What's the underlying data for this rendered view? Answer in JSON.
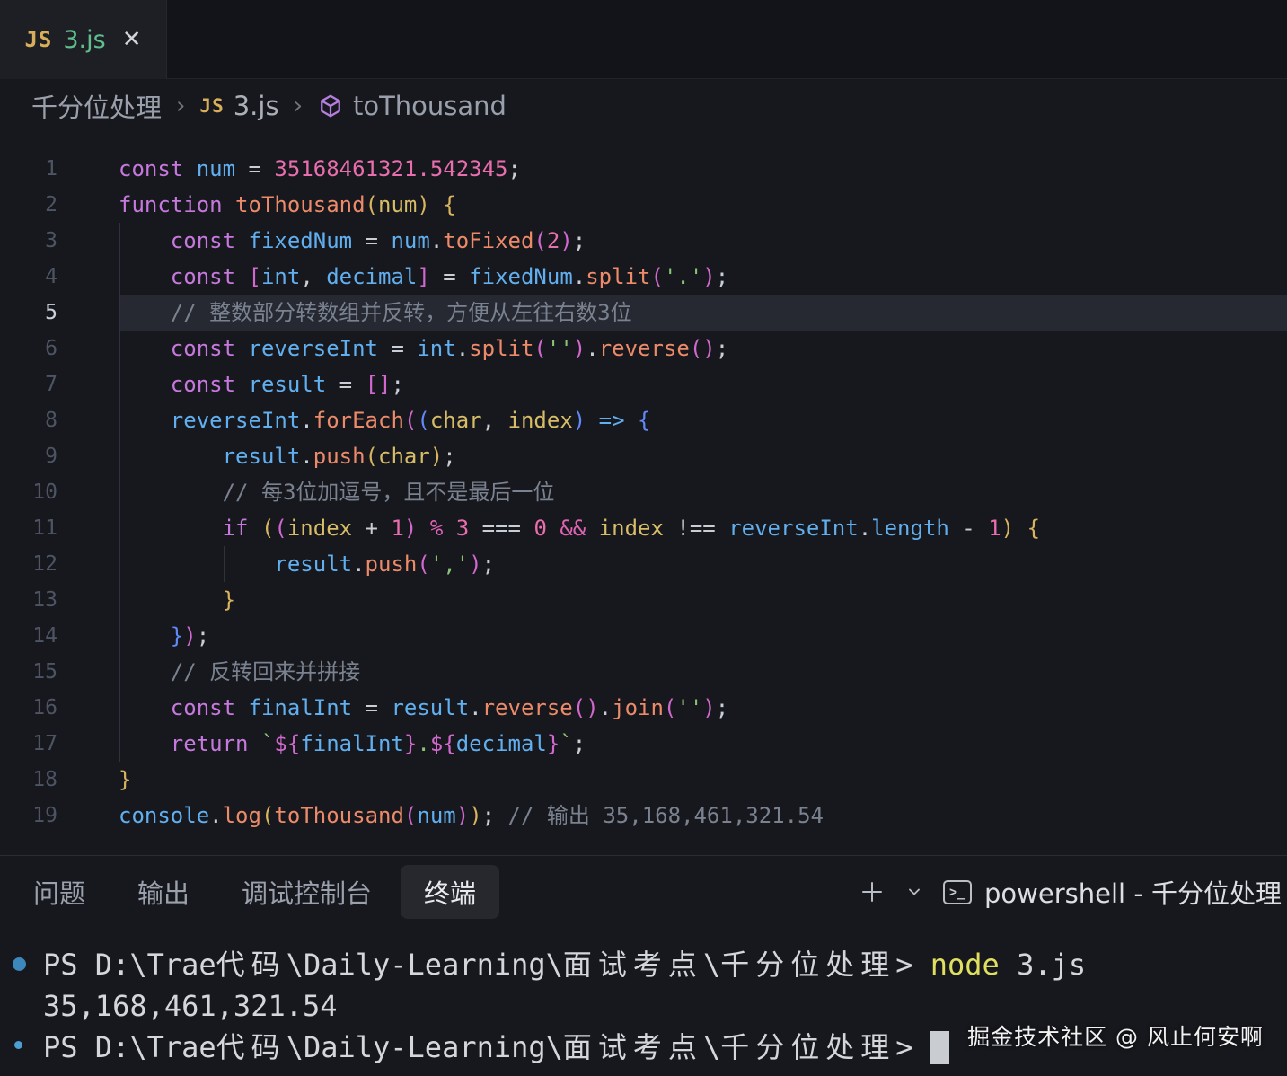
{
  "tab": {
    "icon": "JS",
    "filename": "3.js",
    "close": "✕"
  },
  "breadcrumb": {
    "folder": "千分位处理",
    "separator": "›",
    "file_icon": "JS",
    "file": "3.js",
    "symbol": "toThousand"
  },
  "editor": {
    "lines": [
      {
        "n": "1",
        "indent": 0,
        "highlight": false,
        "tokens": [
          [
            "kw",
            "const"
          ],
          [
            "op",
            " "
          ],
          [
            "var",
            "num"
          ],
          [
            "op",
            " = "
          ],
          [
            "num",
            "35168461321.542345"
          ],
          [
            "op",
            ";"
          ]
        ]
      },
      {
        "n": "2",
        "indent": 0,
        "highlight": false,
        "tokens": [
          [
            "kw",
            "function"
          ],
          [
            "op",
            " "
          ],
          [
            "fn",
            "toThousand"
          ],
          [
            "b1",
            "("
          ],
          [
            "param",
            "num"
          ],
          [
            "b1",
            ")"
          ],
          [
            "op",
            " "
          ],
          [
            "b1",
            "{"
          ]
        ]
      },
      {
        "n": "3",
        "indent": 1,
        "highlight": false,
        "tokens": [
          [
            "kw",
            "const"
          ],
          [
            "op",
            " "
          ],
          [
            "var",
            "fixedNum"
          ],
          [
            "op",
            " = "
          ],
          [
            "var",
            "num"
          ],
          [
            "op",
            "."
          ],
          [
            "fn",
            "toFixed"
          ],
          [
            "b2",
            "("
          ],
          [
            "num",
            "2"
          ],
          [
            "b2",
            ")"
          ],
          [
            "op",
            ";"
          ]
        ]
      },
      {
        "n": "4",
        "indent": 1,
        "highlight": false,
        "tokens": [
          [
            "kw",
            "const"
          ],
          [
            "op",
            " "
          ],
          [
            "b2",
            "["
          ],
          [
            "var",
            "int"
          ],
          [
            "op",
            ", "
          ],
          [
            "var",
            "decimal"
          ],
          [
            "b2",
            "]"
          ],
          [
            "op",
            " = "
          ],
          [
            "var",
            "fixedNum"
          ],
          [
            "op",
            "."
          ],
          [
            "fn",
            "split"
          ],
          [
            "b2",
            "("
          ],
          [
            "str",
            "'.'"
          ],
          [
            "b2",
            ")"
          ],
          [
            "op",
            ";"
          ]
        ]
      },
      {
        "n": "5",
        "indent": 1,
        "highlight": true,
        "tokens": [
          [
            "com",
            "// 整数部分转数组并反转，方便从左往右数3位"
          ]
        ]
      },
      {
        "n": "6",
        "indent": 1,
        "highlight": false,
        "tokens": [
          [
            "kw",
            "const"
          ],
          [
            "op",
            " "
          ],
          [
            "var",
            "reverseInt"
          ],
          [
            "op",
            " = "
          ],
          [
            "var",
            "int"
          ],
          [
            "op",
            "."
          ],
          [
            "fn",
            "split"
          ],
          [
            "b2",
            "("
          ],
          [
            "str",
            "''"
          ],
          [
            "b2",
            ")"
          ],
          [
            "op",
            "."
          ],
          [
            "fn",
            "reverse"
          ],
          [
            "b2",
            "()"
          ],
          [
            "op",
            ";"
          ]
        ]
      },
      {
        "n": "7",
        "indent": 1,
        "highlight": false,
        "tokens": [
          [
            "kw",
            "const"
          ],
          [
            "op",
            " "
          ],
          [
            "var",
            "result"
          ],
          [
            "op",
            " = "
          ],
          [
            "b2",
            "[]"
          ],
          [
            "op",
            ";"
          ]
        ]
      },
      {
        "n": "8",
        "indent": 1,
        "highlight": false,
        "tokens": [
          [
            "var",
            "reverseInt"
          ],
          [
            "op",
            "."
          ],
          [
            "fn",
            "forEach"
          ],
          [
            "b2",
            "("
          ],
          [
            "b3",
            "("
          ],
          [
            "param",
            "char"
          ],
          [
            "op",
            ", "
          ],
          [
            "param",
            "index"
          ],
          [
            "b3",
            ")"
          ],
          [
            "op",
            " "
          ],
          [
            "arrow",
            "=>"
          ],
          [
            "op",
            " "
          ],
          [
            "b3",
            "{"
          ]
        ]
      },
      {
        "n": "9",
        "indent": 2,
        "highlight": false,
        "tokens": [
          [
            "var",
            "result"
          ],
          [
            "op",
            "."
          ],
          [
            "fn",
            "push"
          ],
          [
            "b1",
            "("
          ],
          [
            "param",
            "char"
          ],
          [
            "b1",
            ")"
          ],
          [
            "op",
            ";"
          ]
        ]
      },
      {
        "n": "10",
        "indent": 2,
        "highlight": false,
        "tokens": [
          [
            "com",
            "// 每3位加逗号，且不是最后一位"
          ]
        ]
      },
      {
        "n": "11",
        "indent": 2,
        "highlight": false,
        "tokens": [
          [
            "kw",
            "if"
          ],
          [
            "op",
            " "
          ],
          [
            "b1",
            "("
          ],
          [
            "b2",
            "("
          ],
          [
            "param",
            "index"
          ],
          [
            "op",
            " + "
          ],
          [
            "num",
            "1"
          ],
          [
            "b2",
            ")"
          ],
          [
            "op",
            " "
          ],
          [
            "opm",
            "%"
          ],
          [
            "op",
            " "
          ],
          [
            "num",
            "3"
          ],
          [
            "op",
            " === "
          ],
          [
            "num",
            "0"
          ],
          [
            "op",
            " "
          ],
          [
            "opm",
            "&&"
          ],
          [
            "op",
            " "
          ],
          [
            "param",
            "index"
          ],
          [
            "op",
            " !== "
          ],
          [
            "var",
            "reverseInt"
          ],
          [
            "op",
            "."
          ],
          [
            "var",
            "length"
          ],
          [
            "op",
            " - "
          ],
          [
            "num",
            "1"
          ],
          [
            "b1",
            ")"
          ],
          [
            "op",
            " "
          ],
          [
            "b1",
            "{"
          ]
        ]
      },
      {
        "n": "12",
        "indent": 3,
        "highlight": false,
        "tokens": [
          [
            "var",
            "result"
          ],
          [
            "op",
            "."
          ],
          [
            "fn",
            "push"
          ],
          [
            "b2",
            "("
          ],
          [
            "str",
            "','"
          ],
          [
            "b2",
            ")"
          ],
          [
            "op",
            ";"
          ]
        ]
      },
      {
        "n": "13",
        "indent": 2,
        "highlight": false,
        "tokens": [
          [
            "b1",
            "}"
          ]
        ]
      },
      {
        "n": "14",
        "indent": 1,
        "highlight": false,
        "tokens": [
          [
            "b3",
            "}"
          ],
          [
            "b2",
            ")"
          ],
          [
            "op",
            ";"
          ]
        ]
      },
      {
        "n": "15",
        "indent": 1,
        "highlight": false,
        "tokens": [
          [
            "com",
            "// 反转回来并拼接"
          ]
        ]
      },
      {
        "n": "16",
        "indent": 1,
        "highlight": false,
        "tokens": [
          [
            "kw",
            "const"
          ],
          [
            "op",
            " "
          ],
          [
            "var",
            "finalInt"
          ],
          [
            "op",
            " = "
          ],
          [
            "var",
            "result"
          ],
          [
            "op",
            "."
          ],
          [
            "fn",
            "reverse"
          ],
          [
            "b2",
            "()"
          ],
          [
            "op",
            "."
          ],
          [
            "fn",
            "join"
          ],
          [
            "b2",
            "("
          ],
          [
            "str",
            "''"
          ],
          [
            "b2",
            ")"
          ],
          [
            "op",
            ";"
          ]
        ]
      },
      {
        "n": "17",
        "indent": 1,
        "highlight": false,
        "tokens": [
          [
            "kw",
            "return"
          ],
          [
            "op",
            " "
          ],
          [
            "str",
            "`"
          ],
          [
            "b2",
            "${"
          ],
          [
            "var",
            "finalInt"
          ],
          [
            "b2",
            "}"
          ],
          [
            "str",
            "."
          ],
          [
            "b2",
            "${"
          ],
          [
            "var",
            "decimal"
          ],
          [
            "b2",
            "}"
          ],
          [
            "str",
            "`"
          ],
          [
            "op",
            ";"
          ]
        ]
      },
      {
        "n": "18",
        "indent": 0,
        "highlight": false,
        "tokens": [
          [
            "b1",
            "}"
          ]
        ]
      },
      {
        "n": "19",
        "indent": 0,
        "highlight": false,
        "tokens": [
          [
            "var",
            "console"
          ],
          [
            "op",
            "."
          ],
          [
            "fn",
            "log"
          ],
          [
            "b1",
            "("
          ],
          [
            "fn",
            "toThousand"
          ],
          [
            "b2",
            "("
          ],
          [
            "var",
            "num"
          ],
          [
            "b2",
            ")"
          ],
          [
            "b1",
            ")"
          ],
          [
            "op",
            "; "
          ],
          [
            "com",
            "// 输出 35,168,461,321.54"
          ]
        ]
      }
    ]
  },
  "panel": {
    "tabs": [
      {
        "label": "问题",
        "active": false
      },
      {
        "label": "输出",
        "active": false
      },
      {
        "label": "调试控制台",
        "active": false
      },
      {
        "label": "终端",
        "active": true
      }
    ],
    "terminal_badge": ">_",
    "terminal_label": "powershell - 千分位处理"
  },
  "terminal": {
    "lines": [
      {
        "bullet": "solid",
        "cursor": false,
        "segments": [
          [
            "txt",
            "PS D:\\Trae"
          ],
          [
            "cjk",
            "代码"
          ],
          [
            "txt",
            "\\Daily-Learning\\"
          ],
          [
            "cjk",
            "面试考点"
          ],
          [
            "txt",
            "\\"
          ],
          [
            "cjk",
            "千分位处理"
          ],
          [
            "txt",
            "> "
          ],
          [
            "yel",
            "node"
          ],
          [
            "txt",
            " 3.js"
          ]
        ]
      },
      {
        "bullet": null,
        "cursor": false,
        "segments": [
          [
            "txt",
            "35,168,461,321.54"
          ]
        ]
      },
      {
        "bullet": "ring",
        "cursor": true,
        "segments": [
          [
            "txt",
            "PS D:\\Trae"
          ],
          [
            "cjk",
            "代码"
          ],
          [
            "txt",
            "\\Daily-Learning\\"
          ],
          [
            "cjk",
            "面试考点"
          ],
          [
            "txt",
            "\\"
          ],
          [
            "cjk",
            "千分位处理"
          ],
          [
            "txt",
            "> "
          ]
        ]
      }
    ]
  },
  "watermark": "掘金技术社区 @ 风止何安啊",
  "colors": {
    "bg": "#17181d",
    "bgTabbar": "#131419",
    "bgTabActive": "#1d1f24",
    "bgPanelTab": "#26282e",
    "lineHighlight": "#262932",
    "guide": "#2e323c",
    "kw": "#c678dd",
    "vr": "#61afef",
    "fn": "#ec8a6a",
    "param": "#d8bd68",
    "num": "#e96eae",
    "str": "#8ac475",
    "com": "#7a8290",
    "op": "#c8cdd6",
    "opm": "#de64b4",
    "arrow": "#61afef",
    "b1": "#d8b45e",
    "b2": "#d068ce",
    "b3": "#6189f7",
    "lineNum": "#4d5564",
    "lineNumActive": "#ccd2da",
    "tabJs": "#d9ae5a",
    "tabFile": "#5fbe8d",
    "breadcrumbText": "#9aa0ab",
    "cube": "#b57edf",
    "terminalText": "#d3d6dc",
    "terminalYellow": "#dfdf60",
    "bulletSolid": "#3c87bc",
    "watermark": "#f2f2f2"
  }
}
